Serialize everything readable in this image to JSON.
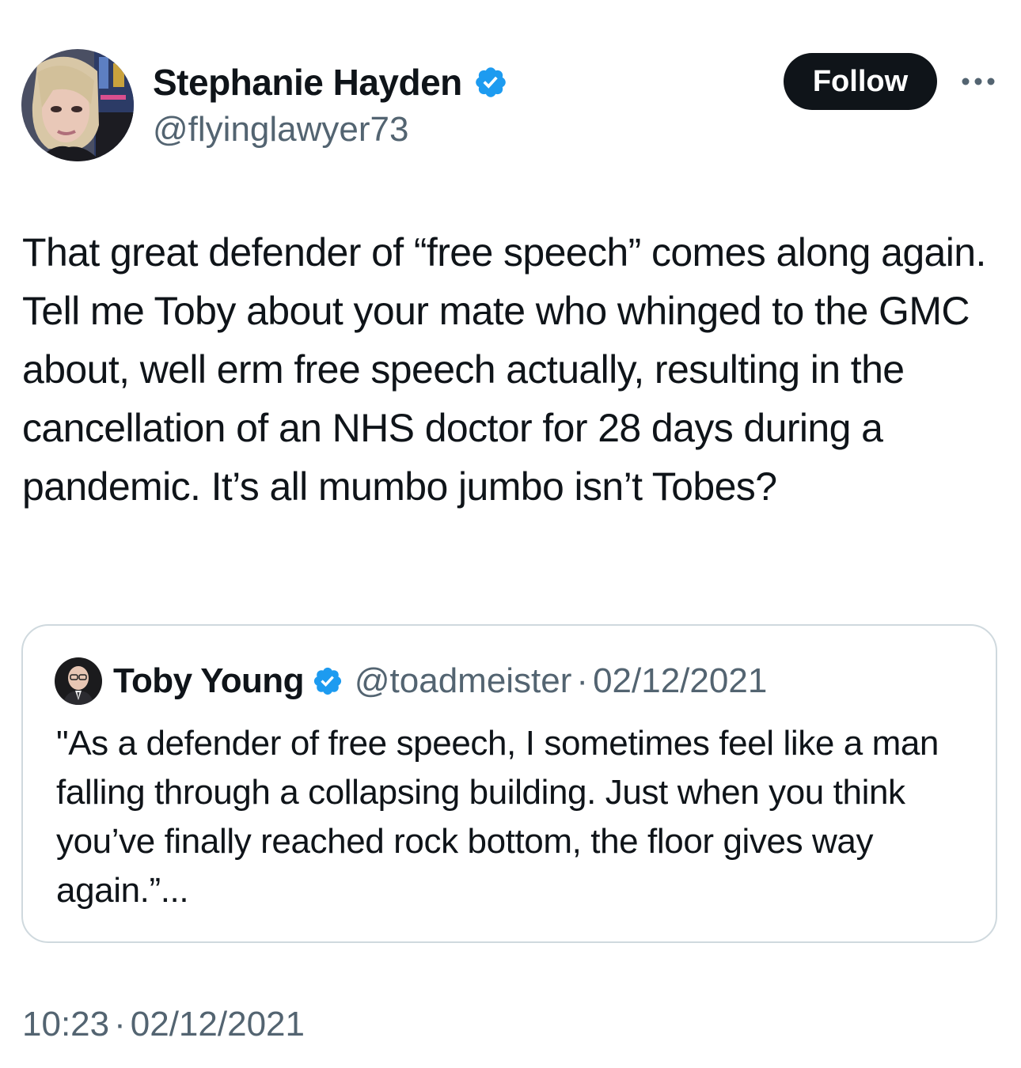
{
  "author": {
    "name": "Stephanie Hayden",
    "handle": "@flyinglawyer73",
    "verified": true
  },
  "follow_label": "Follow",
  "more_icon": "more-horizontal-icon",
  "tweet": {
    "text": "That great defender of “free speech” comes along again. Tell me Toby about your mate who whinged to the GMC about, well erm free speech actually, resulting in the cancellation of an NHS doctor for 28 days during a pandemic. It’s all mumbo jumbo isn’t Tobes?"
  },
  "quoted": {
    "name": "Toby Young",
    "handle": "@toadmeister",
    "separator": "·",
    "date": "02/12/2021",
    "verified": true,
    "text": "\"As a defender of free speech, I sometimes feel like a man falling through a collapsing building. Just when you think you’ve finally reached rock bottom, the floor gives way again.”..."
  },
  "timestamp": {
    "time": "10:23",
    "separator": "·",
    "date": "02/12/2021"
  },
  "colors": {
    "text": "#0f1419",
    "secondary": "#536471",
    "verified_badge": "#1d9bf0",
    "border": "#cfd9de",
    "button_bg": "#0f1419"
  }
}
